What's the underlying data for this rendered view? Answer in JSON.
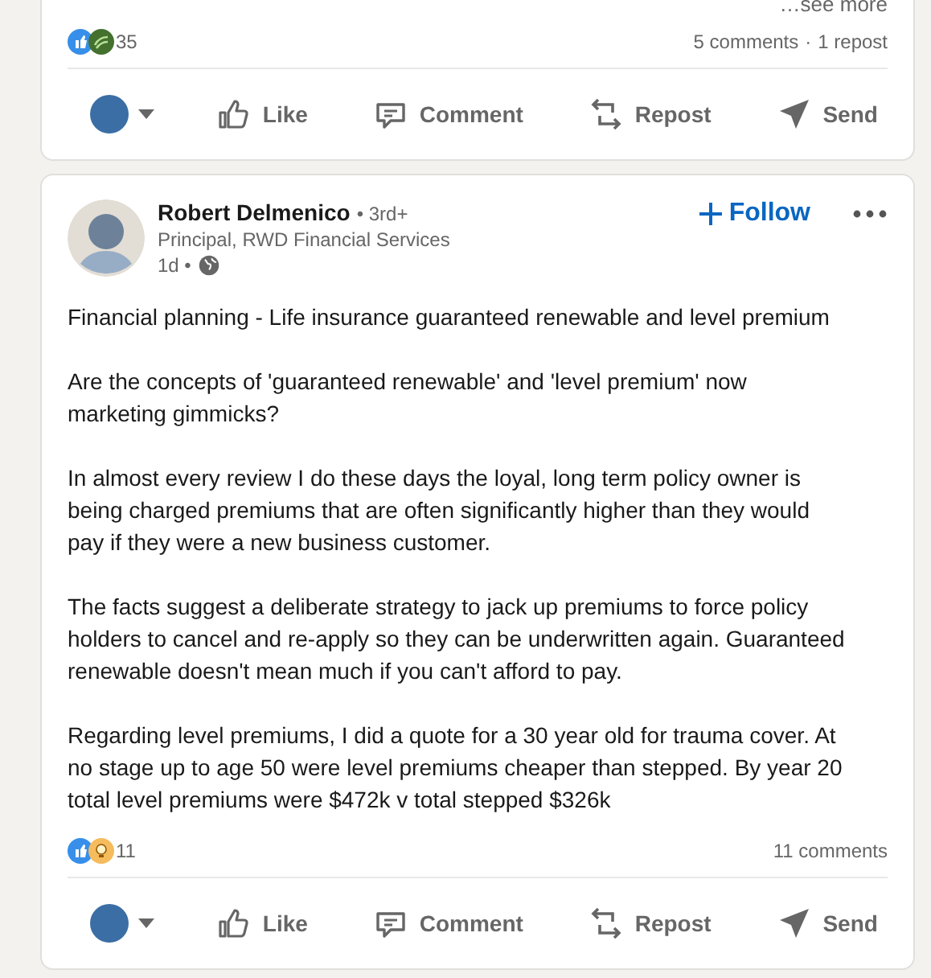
{
  "posts": [
    {
      "see_more": "…see more",
      "reactions": [
        {
          "kind": "like"
        },
        {
          "kind": "support"
        }
      ],
      "reaction_count": "35",
      "comments": "5 comments",
      "separator": "·",
      "reposts": "1 repost",
      "actions": [
        {
          "kind": "like",
          "label": "Like"
        },
        {
          "kind": "comment",
          "label": "Comment"
        },
        {
          "kind": "repost",
          "label": "Repost"
        },
        {
          "kind": "send",
          "label": "Send"
        }
      ]
    },
    {
      "author": {
        "name": "Robert Delmenico",
        "degree": "• 3rd+",
        "headline": "Principal, RWD Financial Services",
        "time": "1d •"
      },
      "follow": "Follow",
      "paragraphs": [
        "Financial planning - Life insurance guaranteed renewable and level premium",
        "Are the concepts of 'guaranteed renewable' and 'level premium' now marketing gimmicks?",
        "In almost every review I do these days the loyal, long term policy owner is being charged premiums that are often significantly higher than they would pay if they were a new business customer.",
        "The facts suggest a deliberate strategy to jack up premiums to force policy holders to cancel and re-apply so they can be underwritten again. Guaranteed renewable doesn't mean much if you can't afford to pay.",
        "Regarding level premiums, I did a quote for a 30 year old for trauma cover. At no stage up to age 50 were level premiums cheaper than stepped. By year 20 total level premiums were $472k v total stepped $326k"
      ],
      "reactions": [
        {
          "kind": "like"
        },
        {
          "kind": "insightful"
        }
      ],
      "reaction_count": "11",
      "comments": "11 comments",
      "actions": [
        {
          "kind": "like",
          "label": "Like"
        },
        {
          "kind": "comment",
          "label": "Comment"
        },
        {
          "kind": "repost",
          "label": "Repost"
        },
        {
          "kind": "send",
          "label": "Send"
        }
      ]
    }
  ]
}
